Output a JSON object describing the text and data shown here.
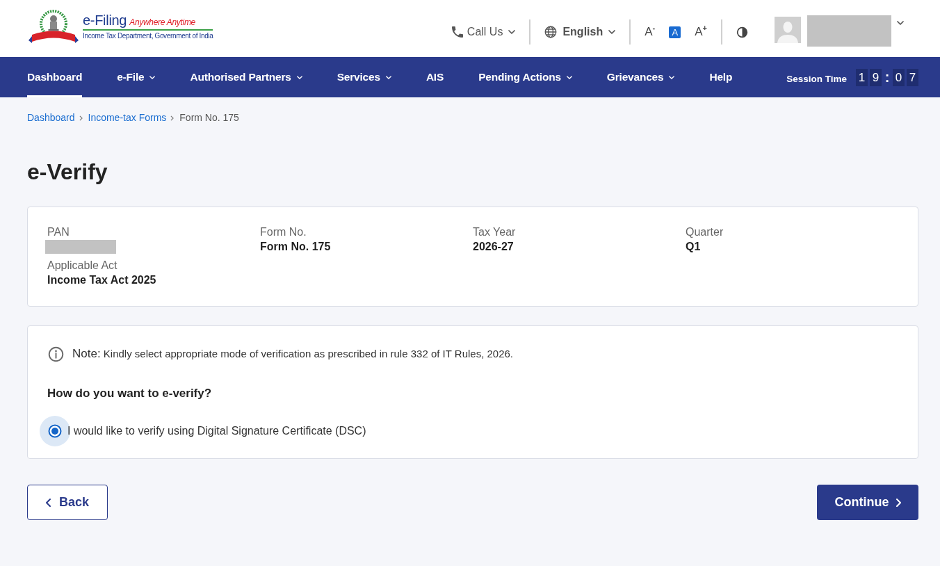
{
  "header": {
    "logo": {
      "title": "e-Filing",
      "tagline": "Anywhere Anytime",
      "subtitle": "Income Tax Department, Government of India"
    },
    "utilities": [
      {
        "kind": "call",
        "label": "Call Us"
      },
      {
        "kind": "language",
        "label": "English"
      }
    ],
    "text_size": [
      {
        "label": "A$^{-}$",
        "selected": false
      },
      {
        "label": "A",
        "selected": true
      },
      {
        "label": "A$^{+}$",
        "selected": false
      }
    ],
    "user": {
      "redacted": true
    }
  },
  "nav": {
    "items": [
      {
        "label": "Dashboard",
        "dropdown": false,
        "selected": true
      },
      {
        "label": "e-File",
        "dropdown": true,
        "selected": false
      },
      {
        "label": "Authorised Partners",
        "dropdown": true,
        "selected": false
      },
      {
        "label": "Services",
        "dropdown": true,
        "selected": false
      },
      {
        "label": "AIS",
        "dropdown": false,
        "selected": false
      },
      {
        "label": "Pending Actions",
        "dropdown": true,
        "selected": false
      },
      {
        "label": "Grievances",
        "dropdown": true,
        "selected": false
      },
      {
        "label": "Help",
        "dropdown": false,
        "selected": false
      }
    ],
    "session": {
      "label": "Session Time",
      "minutes": [
        "1",
        "9"
      ],
      "separator": ":",
      "seconds": [
        "0",
        "7"
      ]
    }
  },
  "breadcrumb": [
    {
      "label": "Dashboard",
      "current": false
    },
    {
      "label": "Income-tax Forms",
      "current": false
    },
    {
      "label": "Form No. 175",
      "current": true
    }
  ],
  "title": "e-Verify",
  "details": [
    {
      "label": "PAN",
      "redacted": true
    },
    {
      "label": "Form No.",
      "value": "Form No. 175"
    },
    {
      "label": "Tax Year",
      "value": "2026-27"
    },
    {
      "label": "Quarter",
      "value": "Q1"
    },
    {
      "label": "Applicable Act",
      "value": "Income Tax Act 2025"
    }
  ],
  "verification": {
    "note": {
      "label": "Note:",
      "text": "Kindly select appropriate mode of verification as prescribed in rule 332 of IT Rules, 2026."
    },
    "question": "How do you want to e-verify?",
    "options": [
      {
        "label": "I would like to verify using Digital Signature Certificate (DSC)",
        "selected": true
      }
    ]
  },
  "actions": [
    {
      "kind": "back",
      "label": "Back"
    },
    {
      "kind": "continue",
      "label": "Continue"
    }
  ]
}
